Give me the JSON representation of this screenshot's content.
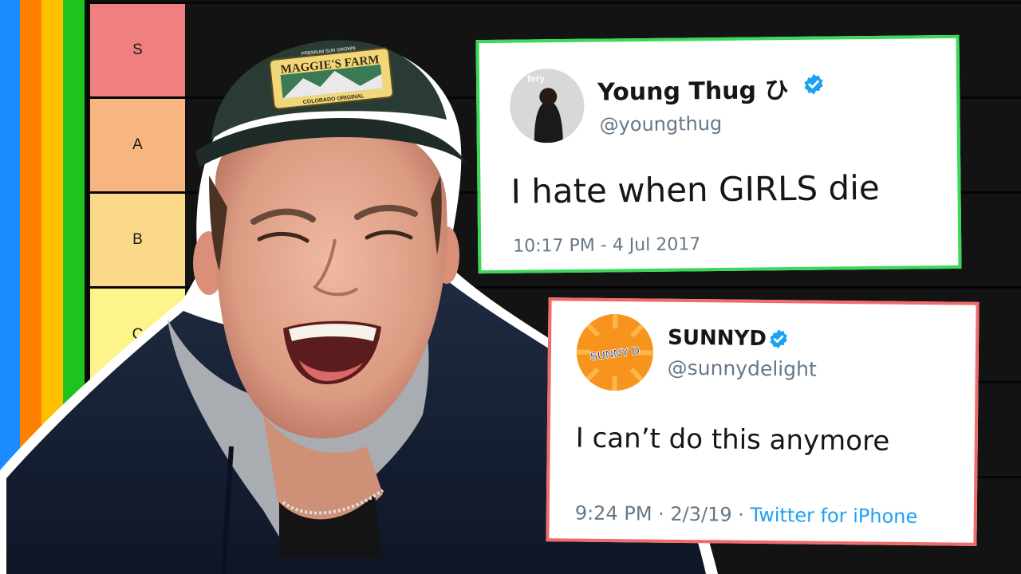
{
  "tier_list": {
    "tiers": [
      {
        "label": "S",
        "color": "#f08080"
      },
      {
        "label": "A",
        "color": "#f7b57f"
      },
      {
        "label": "B",
        "color": "#fbd98a"
      },
      {
        "label": "C",
        "color": "#fdf58a"
      }
    ],
    "side_stripes": [
      "#1a8cff",
      "#ff7f00",
      "#ffc000",
      "#1ec31e"
    ]
  },
  "tweets": [
    {
      "name": "Young Thug ひ",
      "handle": "@youngthug",
      "text": "I hate when GIRLS die",
      "time": "10:17 PM - 4 Jul 2017",
      "avatar_caption": "fery",
      "border_color": "#3bd85a"
    },
    {
      "name": "SUNNYD",
      "handle": "@sunnydelight",
      "text": "I can’t do this anymore",
      "time": "9:24 PM · 2/3/19 · ",
      "source": "Twitter for iPhone",
      "avatar_logo": "SUNNY D",
      "border_color": "#f26b6b"
    }
  ],
  "hat_patch": {
    "top": "PREMIUM SUN GROWN",
    "title": "MAGGIE'S FARM",
    "bottom": "COLORADO ORIGINAL"
  },
  "icons": {
    "verified": "verified-badge-icon"
  }
}
